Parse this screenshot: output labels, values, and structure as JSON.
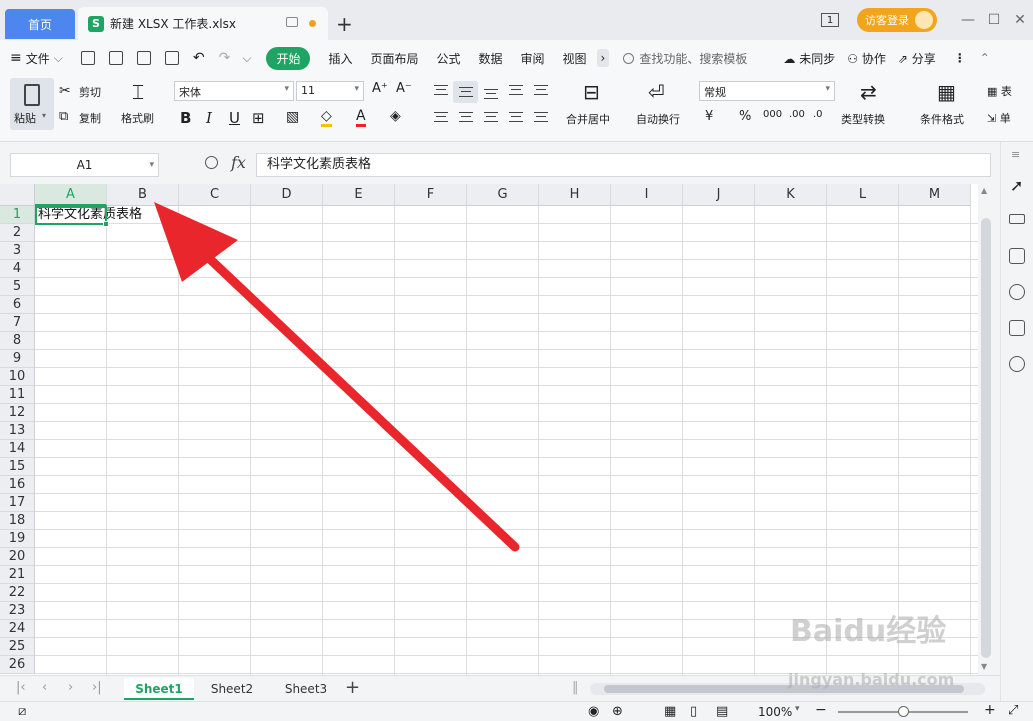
{
  "tabs": {
    "home": "首页",
    "doc_icon": "S",
    "doc_title": "新建 XLSX 工作表.xlsx",
    "login": "访客登录",
    "badge": "1"
  },
  "menu": {
    "file": "文件",
    "start": "开始",
    "insert": "插入",
    "layout": "页面布局",
    "formula": "公式",
    "data": "数据",
    "review": "审阅",
    "view": "视图",
    "search": "查找功能、搜索模板",
    "sync": "未同步",
    "collab": "协作",
    "share": "分享"
  },
  "ribbon": {
    "paste": "粘贴",
    "cut": "剪切",
    "copy": "复制",
    "format_painter": "格式刷",
    "font_name": "宋体",
    "font_size": "11",
    "bold": "B",
    "italic": "I",
    "underline": "U",
    "merge": "合并居中",
    "wrap": "自动换行",
    "number_format": "常规",
    "convert": "类型转换",
    "conditional": "条件格式",
    "table_style": "表",
    "cell": "单"
  },
  "formula": {
    "name_box": "A1",
    "fx": "fx",
    "content": "科学文化素质表格"
  },
  "grid": {
    "columns": [
      "A",
      "B",
      "C",
      "D",
      "E",
      "F",
      "G",
      "H",
      "I",
      "J",
      "K",
      "L",
      "M"
    ],
    "rows": [
      "1",
      "2",
      "3",
      "4",
      "5",
      "6",
      "7",
      "8",
      "9",
      "10",
      "11",
      "12",
      "13",
      "14",
      "15",
      "16",
      "17",
      "18",
      "19",
      "20",
      "21",
      "22",
      "23",
      "24",
      "25",
      "26"
    ],
    "a1_text": "科学文化素质表格"
  },
  "sheets": [
    "Sheet1",
    "Sheet2",
    "Sheet3"
  ],
  "status": {
    "zoom": "100%"
  },
  "watermark": {
    "brand": "Baidu经验",
    "url": "jingyan.baidu.com"
  },
  "colors": {
    "accent": "#1fa463",
    "home_tab": "#4e86f0",
    "login": "#f1a41c",
    "arrow": "#e8262c"
  }
}
